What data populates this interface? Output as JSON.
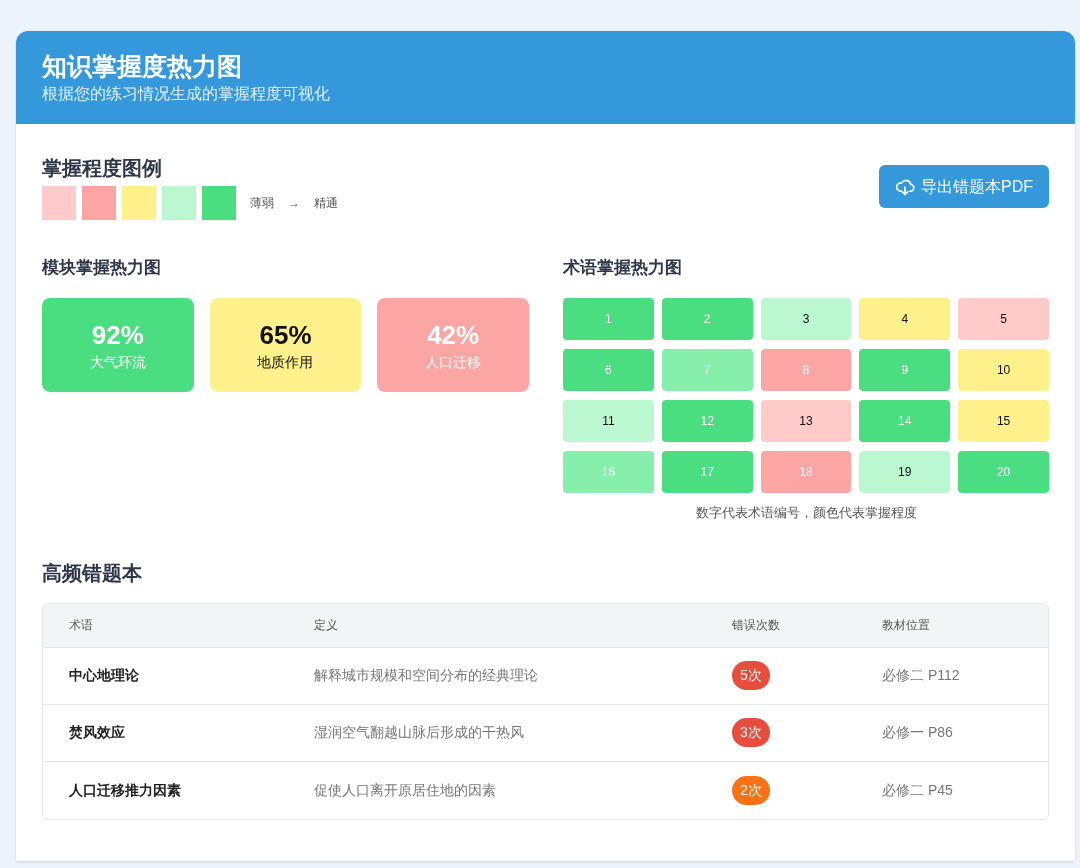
{
  "header": {
    "title": "知识掌握度热力图",
    "subtitle": "根据您的练习情况生成的掌握程度可视化"
  },
  "legend": {
    "title": "掌握程度图例",
    "swatches": [
      {
        "color": "#fecaca"
      },
      {
        "color": "#fca5a5"
      },
      {
        "color": "#fef08a"
      },
      {
        "color": "#bbf7d0"
      },
      {
        "color": "#4ade80"
      }
    ],
    "from": "薄弱",
    "arrow": "→",
    "to": "精通"
  },
  "export_button": {
    "label": "导出错题本PDF"
  },
  "modules": {
    "title": "模块掌握热力图",
    "items": [
      {
        "percent": "92%",
        "name": "大气环流",
        "color": "#4ade80",
        "kind": "light"
      },
      {
        "percent": "65%",
        "name": "地质作用",
        "color": "#fef08a",
        "kind": "dark"
      },
      {
        "percent": "42%",
        "name": "人口迁移",
        "color": "#fca5a5",
        "kind": "light"
      }
    ]
  },
  "terms": {
    "title": "术语掌握热力图",
    "cells": [
      {
        "label": "1",
        "color": "#4ade80",
        "kind": "light"
      },
      {
        "label": "2",
        "color": "#4ade80",
        "kind": "light"
      },
      {
        "label": "3",
        "color": "#bbf7d0",
        "kind": "dark"
      },
      {
        "label": "4",
        "color": "#fef08a",
        "kind": "dark"
      },
      {
        "label": "5",
        "color": "#fecaca",
        "kind": "dark"
      },
      {
        "label": "6",
        "color": "#4ade80",
        "kind": "light"
      },
      {
        "label": "7",
        "color": "#86efac",
        "kind": "light"
      },
      {
        "label": "8",
        "color": "#fca5a5",
        "kind": "light"
      },
      {
        "label": "9",
        "color": "#4ade80",
        "kind": "light"
      },
      {
        "label": "10",
        "color": "#fef08a",
        "kind": "dark"
      },
      {
        "label": "11",
        "color": "#bbf7d0",
        "kind": "dark"
      },
      {
        "label": "12",
        "color": "#4ade80",
        "kind": "light"
      },
      {
        "label": "13",
        "color": "#fecaca",
        "kind": "dark"
      },
      {
        "label": "14",
        "color": "#4ade80",
        "kind": "light"
      },
      {
        "label": "15",
        "color": "#fef08a",
        "kind": "dark"
      },
      {
        "label": "16",
        "color": "#86efac",
        "kind": "light"
      },
      {
        "label": "17",
        "color": "#4ade80",
        "kind": "light"
      },
      {
        "label": "18",
        "color": "#fca5a5",
        "kind": "light"
      },
      {
        "label": "19",
        "color": "#bbf7d0",
        "kind": "dark"
      },
      {
        "label": "20",
        "color": "#4ade80",
        "kind": "light"
      }
    ],
    "caption": "数字代表术语编号，颜色代表掌握程度"
  },
  "mistakes": {
    "title": "高频错题本",
    "columns": [
      "术语",
      "定义",
      "错误次数",
      "教材位置"
    ],
    "rows": [
      {
        "term": "中心地理论",
        "definition": "解释城市规模和空间分布的经典理论",
        "count": "5次",
        "color": "#e74c3c",
        "location": "必修二 P112"
      },
      {
        "term": "焚风效应",
        "definition": "湿润空气翻越山脉后形成的干热风",
        "count": "3次",
        "color": "#e74c3c",
        "location": "必修一 P86"
      },
      {
        "term": "人口迁移推力因素",
        "definition": "促使人口离开原居住地的因素",
        "count": "2次",
        "color": "#f97316",
        "location": "必修二 P45"
      }
    ]
  }
}
